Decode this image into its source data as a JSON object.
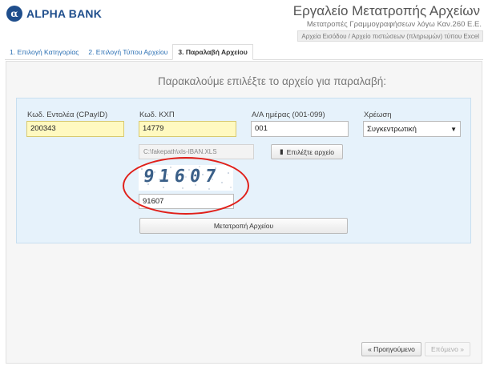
{
  "brand": {
    "logo_text": "ALPHA BANK",
    "logo_mark": "α"
  },
  "header": {
    "title": "Εργαλείο Μετατροπής Αρχείων",
    "subtitle": "Μετατροπές Γραμμογραφήσεων λόγω Καν.260 Ε.Ε.",
    "breadcrumb": "Αρχεία Εισόδου / Αρχείο πιστώσεων (πληρωμών) τύπου Excel"
  },
  "tabs": [
    {
      "label": "1. Επιλογή Κατηγορίας",
      "active": false
    },
    {
      "label": "2. Επιλογή Τύπου Αρχείου",
      "active": false
    },
    {
      "label": "3. Παραλαβή Αρχείου",
      "active": true
    }
  ],
  "main": {
    "heading": "Παρακαλούμε επιλέξτε το αρχείο για παραλαβή:"
  },
  "form": {
    "fields": {
      "cpayid": {
        "label": "Κωδ. Εντολέα (CPayID)",
        "value": "200343"
      },
      "kxp": {
        "label": "Κωδ. ΚΧΠ",
        "value": "14779"
      },
      "day_seq": {
        "label": "Α/Α ημέρας (001-099)",
        "value": "001"
      },
      "charge": {
        "label": "Χρέωση",
        "value": "Συγκεντρωτική"
      }
    },
    "file_path": "C:\\fakepath\\xls-IBAN.XLS",
    "choose_file_label": "Επιλέξτε αρχείο",
    "captcha_text": "91607",
    "captcha_input_value": "91607",
    "convert_label": "Μετατροπή Αρχείου"
  },
  "pager": {
    "prev_label": "« Προηγούμενο",
    "next_label": "Επόμενο »"
  },
  "colors": {
    "brand": "#1f4e8c",
    "highlight_field": "#fff9c0",
    "panel": "#e6f2fb",
    "annotation": "#e0201a"
  }
}
